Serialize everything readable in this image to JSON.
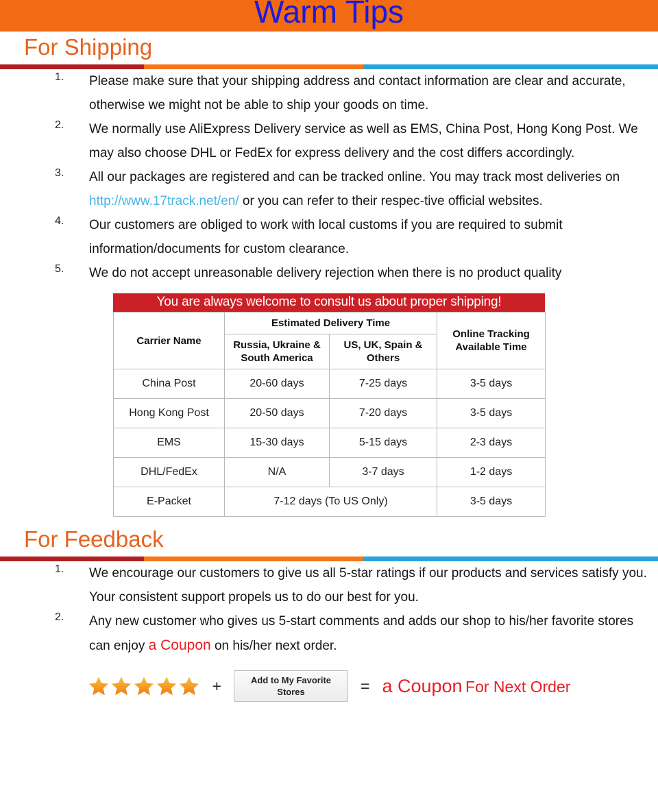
{
  "banner": {
    "title": "Warm Tips",
    "bg_color": "#F26A12",
    "title_color": "#1A1AE0"
  },
  "shipping": {
    "heading": "For Shipping",
    "heading_color": "#E8621C",
    "items": [
      {
        "number": "1.",
        "text": "Please make sure that your shipping address and contact information are clear and accurate, otherwise we might not be able to ship your goods on time."
      },
      {
        "number": "2.",
        "text": "We normally use AliExpress Delivery service as well as EMS, China Post, Hong Kong Post. We may also choose DHL or FedEx for express delivery and the cost differs accordingly."
      },
      {
        "number": "3.",
        "text_before_link": "All our packages are registered and can be tracked online.  You may track most deliveries on ",
        "link_text": "http://www.17track.net/en/",
        "link_color": "#4BB3E6",
        "text_after_link": " or you can refer to their respec-tive official websites."
      },
      {
        "number": "4.",
        "text": "Our customers are obliged to work with local customs if you are required to submit information/documents for custom clearance."
      },
      {
        "number": "5.",
        "text": "We do not accept unreasonable delivery rejection when there is no product quality"
      }
    ]
  },
  "table": {
    "banner_text": "You are always welcome to consult us about proper shipping!",
    "banner_color": "#CC2027",
    "headers": {
      "carrier": "Carrier Name",
      "estimated_group": "Estimated Delivery Time",
      "region_a": "Russia, Ukraine & South America",
      "region_b": "US, UK, Spain & Others",
      "tracking": "Online Tracking Available Time"
    },
    "rows": [
      {
        "carrier": "China Post",
        "region_a": "20-60 days",
        "region_b": "7-25 days",
        "tracking": "3-5 days",
        "merged": false
      },
      {
        "carrier": "Hong Kong Post",
        "region_a": "20-50 days",
        "region_b": "7-20 days",
        "tracking": "3-5 days",
        "merged": false
      },
      {
        "carrier": "EMS",
        "region_a": "15-30 days",
        "region_b": "5-15 days",
        "tracking": "2-3 days",
        "merged": false
      },
      {
        "carrier": "DHL/FedEx",
        "region_a": "N/A",
        "region_b": "3-7 days",
        "tracking": "1-2 days",
        "merged": false
      },
      {
        "carrier": "E-Packet",
        "merged_value": "7-12 days (To US Only)",
        "tracking": "3-5 days",
        "merged": true
      }
    ]
  },
  "feedback": {
    "heading": "For Feedback",
    "heading_color": "#E8621C",
    "items": [
      {
        "number": "1.",
        "text": "We encourage our customers to give us all 5-star ratings if our products and services satisfy you. Your consistent support propels us to do our best for you."
      },
      {
        "number": "2.",
        "text_before": "Any new customer who gives us 5-start comments and adds our shop to his/her favorite stores can enjoy ",
        "highlight": "a Coupon",
        "highlight_color": "#EE1C21",
        "text_after": " on his/her next order."
      }
    ]
  },
  "formula": {
    "star_count": 5,
    "star_color": "#F39A1E",
    "plus": "+",
    "button_label": "Add to My Favorite Stores",
    "equals": "=",
    "result_highlight": "a Coupon",
    "result_rest": "For Next Order",
    "result_color": "#EE1C21"
  }
}
